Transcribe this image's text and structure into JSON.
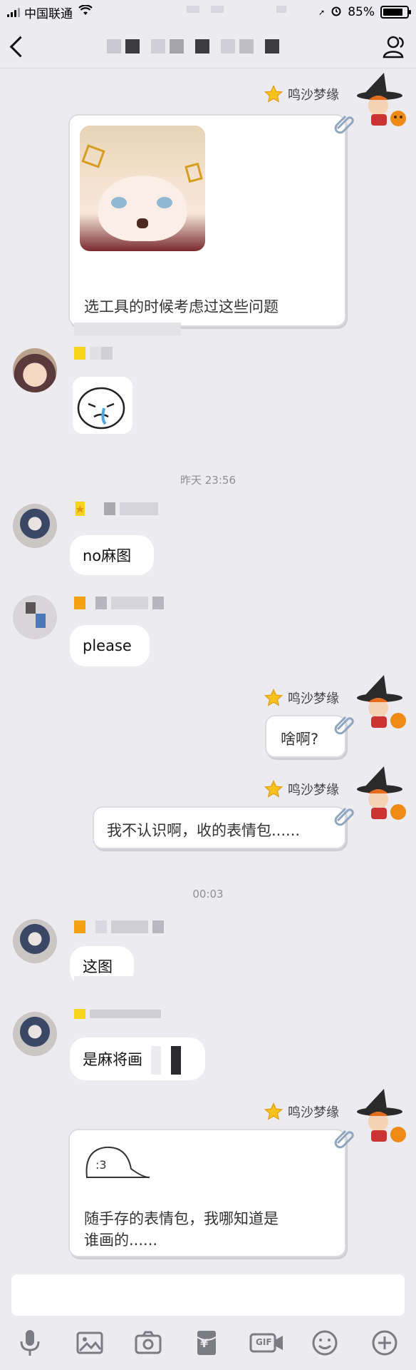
{
  "status_bar": {
    "carrier": "中国联通",
    "battery_percent": "85%",
    "battery_level": 0.85
  },
  "nav": {
    "back_icon": "chevron-left-icon",
    "profile_icon": "contacts-icon"
  },
  "me": {
    "name": "鸣沙梦缘"
  },
  "messages": {
    "m1": {
      "text": "选工具的时候考虑过这些问题"
    },
    "t1": "昨天 23:56",
    "m3": {
      "text": "no麻图"
    },
    "m4": {
      "text": "please"
    },
    "m5": {
      "text": "啥啊?"
    },
    "m6": {
      "text": "我不认识啊，收的表情包......"
    },
    "t2": "00:03",
    "m7": {
      "text": "这图"
    },
    "m8": {
      "text": "是麻将画"
    },
    "m9": {
      "line1": "随手存的表情包，我哪知道是",
      "line2": "谁画的......"
    }
  },
  "toolbar": {
    "items": [
      "mic-icon",
      "image-icon",
      "camera-icon",
      "red-packet-icon",
      "gif-icon",
      "emoji-icon",
      "plus-icon"
    ],
    "gif_label": "GIF",
    "yen_label": "¥"
  },
  "colors": {
    "background": "#ecebf0",
    "star": "#f7c21b",
    "tag_orange": "#f5a011",
    "tag_yellow": "#f7d31b"
  }
}
